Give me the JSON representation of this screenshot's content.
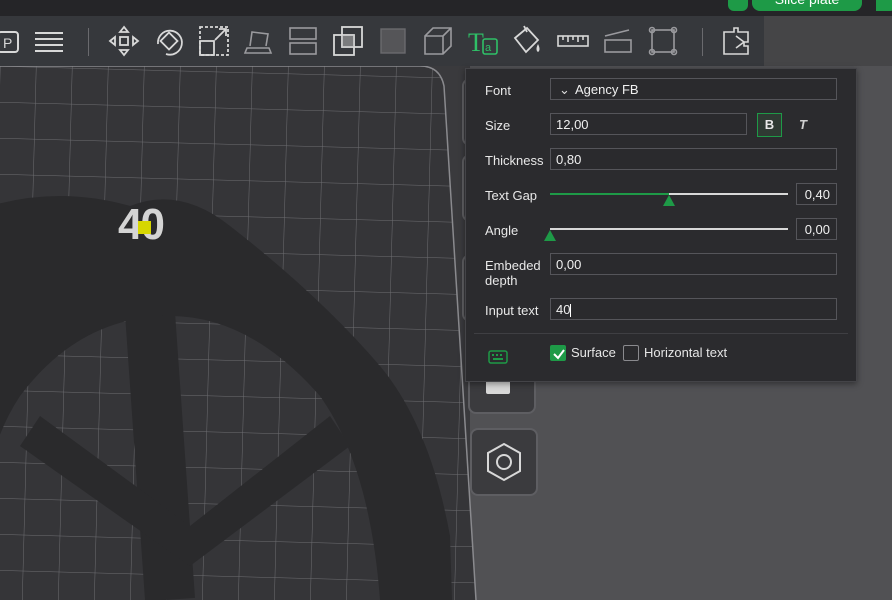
{
  "topbar": {
    "slice_button_label": "Slice plate"
  },
  "toolbar": {
    "icons": [
      "plate-icon",
      "layers-icon",
      "move-icon",
      "rotate-icon",
      "scale-icon",
      "lay-on-face-icon",
      "split-icon",
      "boolean-icon",
      "support-paint-icon",
      "cube-icon",
      "text-tool-icon",
      "paint-bucket-icon",
      "measure-icon",
      "cut-icon",
      "mesh-boolean-icon",
      "assembly-icon"
    ]
  },
  "viewport": {
    "model_text": "40"
  },
  "text_panel": {
    "font_label": "Font",
    "font_value": "Agency FB",
    "size_label": "Size",
    "size_value": "12,00",
    "bold_label": "B",
    "italic_label": "T",
    "thickness_label": "Thickness",
    "thickness_value": "0,80",
    "text_gap_label": "Text Gap",
    "text_gap_value": "0,40",
    "text_gap_fraction": 0.5,
    "angle_label": "Angle",
    "angle_value": "0,00",
    "angle_fraction": 0.0,
    "embeded_label_line1": "Embeded",
    "embeded_label_line2": "depth",
    "embeded_value": "0,00",
    "input_text_label": "Input text",
    "input_text_value": "40",
    "surface_label": "Surface",
    "surface_checked": true,
    "horizontal_label": "Horizontal text",
    "horizontal_checked": false
  },
  "colors": {
    "accent": "#1e9a47",
    "panel": "#2b2b2e",
    "bed": "#353538",
    "model": "#2a2a2c"
  }
}
